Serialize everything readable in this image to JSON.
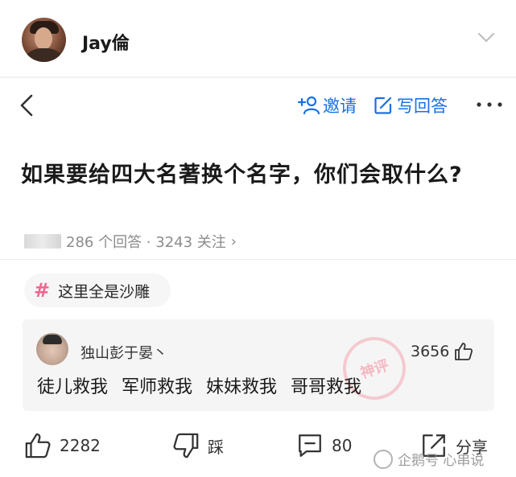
{
  "header": {
    "author_name": "Jay倫"
  },
  "toolbar": {
    "invite_label": "邀请",
    "answer_label": "写回答"
  },
  "question": {
    "title": "如果要给四大名著换个名字，你们会取什么?",
    "meta": "286 个回答 · 3243 关注"
  },
  "topic": {
    "label": "这里全是沙雕",
    "color": "#f0668f"
  },
  "comment": {
    "username": "独山彭于晏丶",
    "likes": "3656",
    "stamp_text": "神评",
    "body": "徒儿救我 军师救我 妹妹救我 哥哥救我"
  },
  "actions": {
    "like_count": "2282",
    "dislike_label": "踩",
    "comment_count": "80",
    "share_label": "分享"
  },
  "watermark": {
    "text": "企鹅号 心串说"
  },
  "colors": {
    "accent_blue": "#1770e6",
    "tag_pink": "#f0668f"
  }
}
